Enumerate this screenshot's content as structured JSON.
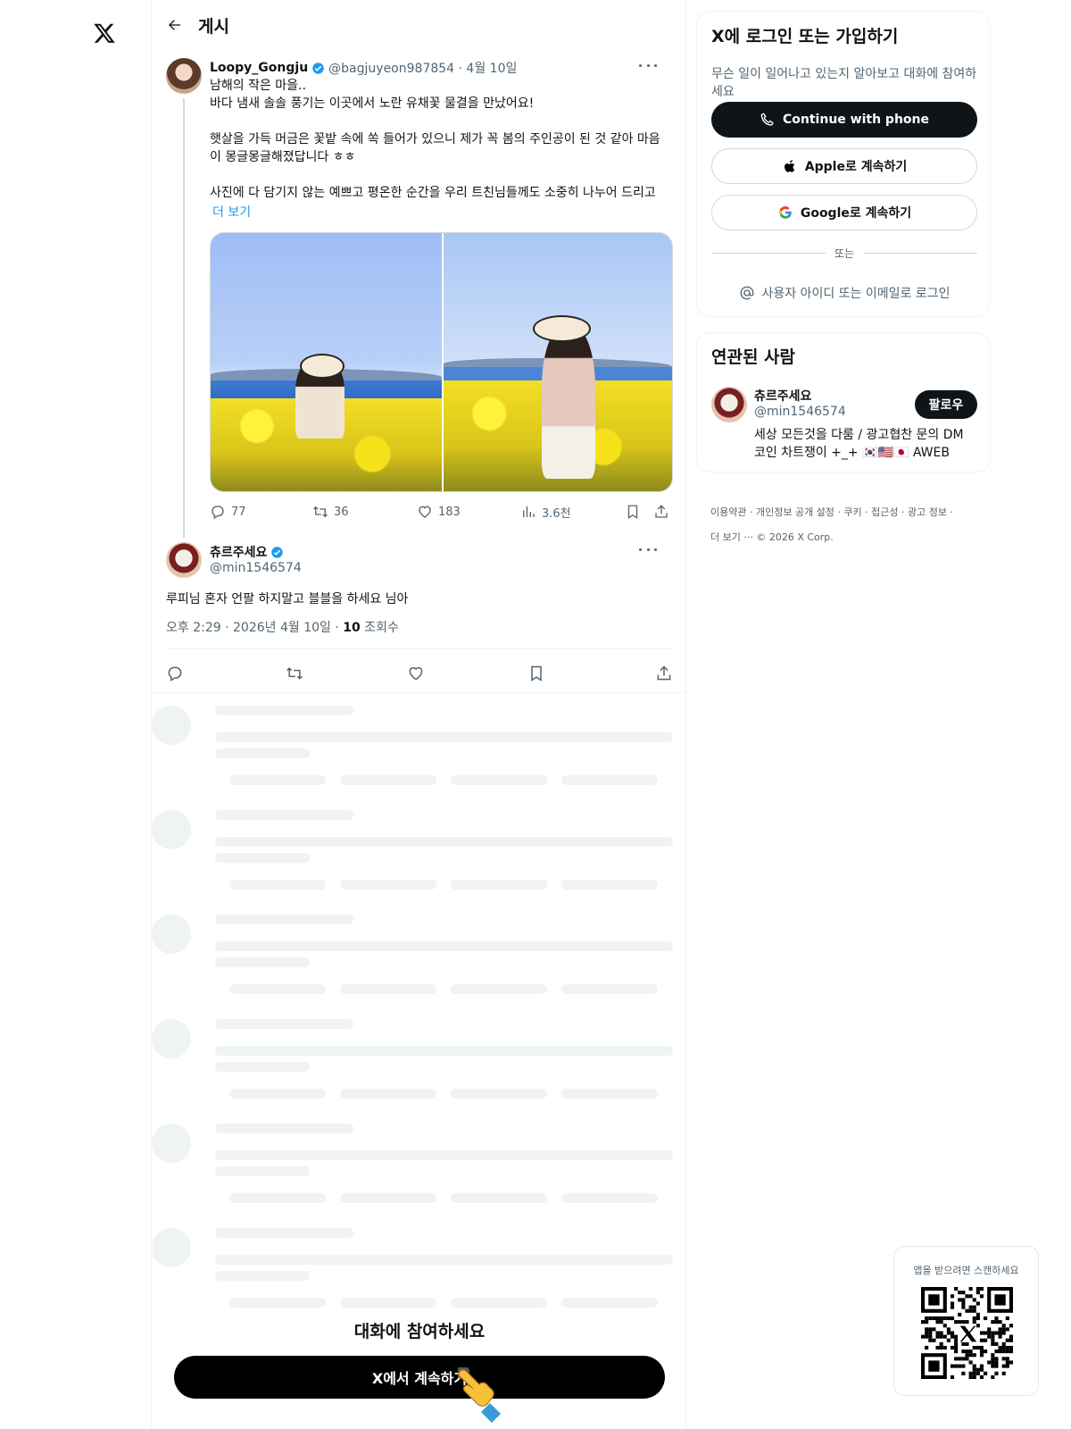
{
  "header": {
    "title": "게시"
  },
  "tweet": {
    "name": "Loopy_Gongju",
    "handle_date": "@bagjuyeon987854 · 4월 10일",
    "text": "남해의 작은 마을..\n바다 냄새 솔솔 풍기는 이곳에서 노란 유채꽃 물결을 만났어요!\n\n햇살을 가득 머금은 꽃밭 속에 쏙 들어가 있으니 제가 꼭 봄의 주인공이 된 것 같아 마음이 몽글몽글해졌답니다 ㅎㅎ\n\n사진에 다 담기지 않는  예쁘고 평온한 순간을 우리 트친님들께도 소중히 나누어 드리고",
    "show_more": "더 보기",
    "replies": "77",
    "reposts": "36",
    "likes": "183",
    "views": "3.6천"
  },
  "reply": {
    "name": "츄르주세요",
    "handle": "@min1546574",
    "text": "루피님 혼자 언팔 하지말고 블블을 하세요 님아",
    "time": "오후 2:29 · 2026년 4월 10일 · ",
    "views_count": "10",
    "views_label": " 조회수"
  },
  "cta": {
    "join": "대화에 참여하세요",
    "button": "X에서 계속하기"
  },
  "signup": {
    "title": "X에 로그인 또는 가입하기",
    "subtitle": "무슨 일이 일어나고 있는지 알아보고 대화에 참여하세요",
    "phone": "Continue with phone",
    "apple": "Apple로 계속하기",
    "google": "Google로 계속하기",
    "or": "또는",
    "login": "사용자 아이디 또는 이메일로 로그인"
  },
  "related": {
    "title": "연관된 사람",
    "name": "츄르주세요",
    "handle": "@min1546574",
    "follow": "팔로우",
    "bio": "세상 모든것을 다룸 / 광고협찬 문의 DM 코인 차트쟁이 +_+ 🇰🇷🇺🇸🇯🇵 AWEB"
  },
  "footer": {
    "line1": "이용약관 · 개인정보 공개 설정 · 쿠키 · 접근성 · 광고 정보 ·",
    "line2": "더 보기 ··· © 2026 X Corp."
  },
  "qr": {
    "label": "앱을 받으려면 스캔하세요"
  },
  "colors": {
    "accent": "#1d9bf0",
    "text": "#0f1419",
    "muted": "#536471",
    "border": "#eff3f4"
  },
  "icons": [
    "x-logo-icon",
    "back-arrow-icon",
    "verified-icon",
    "more-icon",
    "reply-icon",
    "repost-icon",
    "like-icon",
    "views-icon",
    "bookmark-icon",
    "share-icon",
    "phone-icon",
    "apple-icon",
    "google-icon",
    "at-icon",
    "qr-code-icon",
    "pointing-hand-icon"
  ]
}
